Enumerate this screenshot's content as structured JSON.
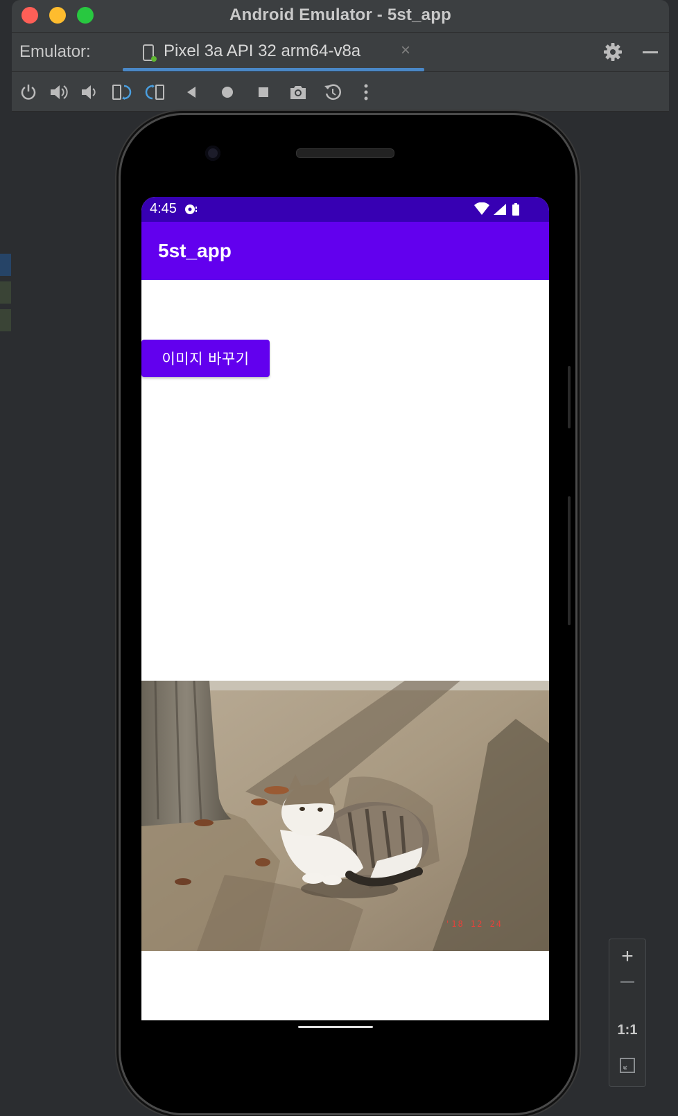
{
  "window": {
    "title": "Android Emulator - 5st_app"
  },
  "tabbar": {
    "label": "Emulator:",
    "tab_title": "Pixel 3a API 32 arm64-v8a",
    "tab_close": "×"
  },
  "toolbar": {
    "buttons": [
      "power-icon",
      "volume-up-icon",
      "volume-down-icon",
      "rotate-left-icon",
      "rotate-right-icon",
      "back-icon",
      "home-icon",
      "overview-icon",
      "camera-icon",
      "snapshot-icon",
      "more-icon"
    ]
  },
  "phone": {
    "status_time": "4:45",
    "app_title": "5st_app",
    "button_label": "이미지 바꾸기",
    "photo_stamp": "'18 12 24"
  },
  "zoom": {
    "plus": "+",
    "one_to_one": "1:1"
  },
  "colors": {
    "status_bar": "#3700b3",
    "app_bar": "#6200ee",
    "button": "#6200ee",
    "tab_underline": "#4a88c7"
  }
}
